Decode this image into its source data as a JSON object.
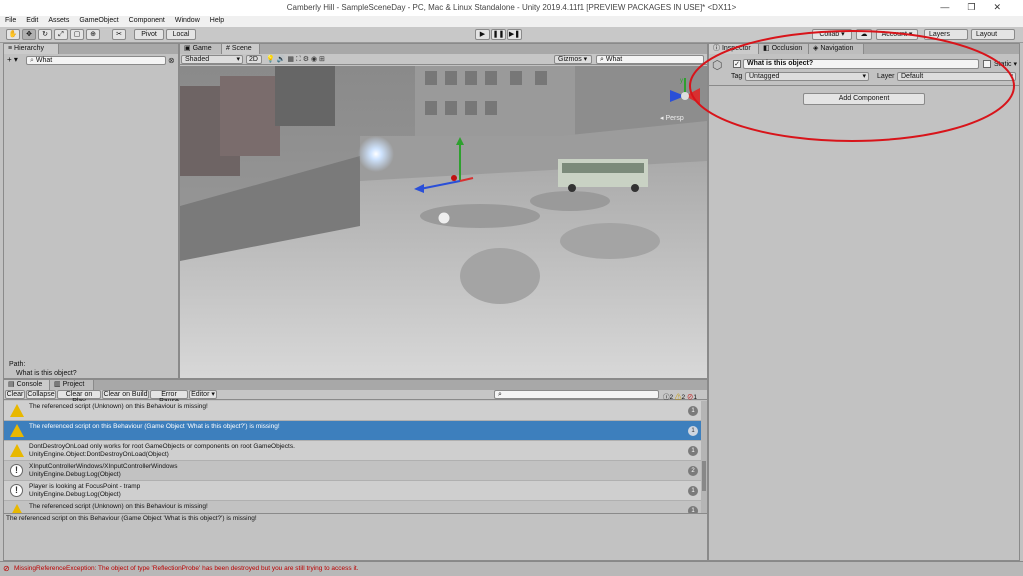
{
  "window": {
    "title": "Camberly Hill - SampleSceneDay - PC, Mac & Linux Standalone - Unity 2019.4.11f1 [PREVIEW PACKAGES IN USE]* <DX11>",
    "controls": [
      "—",
      "❐",
      "✕"
    ]
  },
  "menu": [
    "File",
    "Edit",
    "Assets",
    "GameObject",
    "Component",
    "Window",
    "Help"
  ],
  "toolbar": {
    "pivot": "Pivot",
    "local": "Local",
    "collab": "Collab ▾",
    "account": "Account ▾",
    "layers": "Layers",
    "layout": "Layout"
  },
  "hierarchy": {
    "tab": "Hierarchy",
    "add": "+ ▾",
    "search_value": "What",
    "path_label": "Path:",
    "path_value": "What is this object?"
  },
  "scene_view": {
    "tabs": [
      "Game",
      "Scene"
    ],
    "shading": "Shaded",
    "mode_2d": "2D",
    "gizmos": "Gizmos ▾",
    "search_value": "What",
    "persp": "◂ Persp",
    "axis_y": "y",
    "axis_x": "x"
  },
  "inspector": {
    "tabs": [
      "Inspector",
      "Occlusion",
      "Navigation"
    ],
    "object_name": "What is this object?",
    "static_label": "Static ▾",
    "tag_label": "Tag",
    "tag_value": "Untagged",
    "layer_label": "Layer",
    "layer_value": "Default",
    "add_component": "Add Component"
  },
  "console": {
    "tabs": [
      "Console",
      "Project"
    ],
    "buttons": [
      "Clear",
      "Collapse",
      "Clear on Play",
      "Clear on Build",
      "Error Pause",
      "Editor ▾"
    ],
    "counts": {
      "info": "2",
      "warn": "2",
      "error": "1"
    },
    "rows": [
      {
        "type": "warn",
        "line1": "The referenced script (Unknown) on this Behaviour is missing!",
        "line2": "",
        "count": "1"
      },
      {
        "type": "warn",
        "line1": "The referenced script on this Behaviour (Game Object 'What is this object?') is missing!",
        "line2": "",
        "count": "1"
      },
      {
        "type": "warn",
        "line1": "DontDestroyOnLoad only works for root GameObjects or components on root GameObjects.",
        "line2": "UnityEngine.Object:DontDestroyOnLoad(Object)",
        "count": "1"
      },
      {
        "type": "info",
        "line1": "XInputControllerWindows/XInputControllerWindows",
        "line2": "UnityEngine.Debug:Log(Object)",
        "count": "2"
      },
      {
        "type": "info",
        "line1": "Player is looking at FocusPoint - tramp",
        "line2": "UnityEngine.Debug:Log(Object)",
        "count": "1"
      },
      {
        "type": "warn",
        "line1": "The referenced script (Unknown) on this Behaviour is missing!",
        "line2": "",
        "count": "1"
      }
    ],
    "detail": "The referenced script on this Behaviour (Game Object 'What is this object?') is missing!"
  },
  "status": "MissingReferenceException: The object of type 'ReflectionProbe' has been destroyed but you are still trying to access it."
}
